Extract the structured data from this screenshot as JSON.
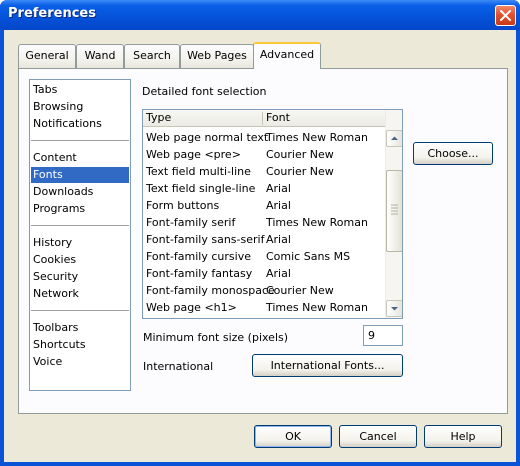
{
  "window": {
    "title": "Preferences"
  },
  "tabs": [
    {
      "label": "General"
    },
    {
      "label": "Wand"
    },
    {
      "label": "Search"
    },
    {
      "label": "Web Pages"
    },
    {
      "label": "Advanced"
    }
  ],
  "categories": {
    "groups": [
      [
        "Tabs",
        "Browsing",
        "Notifications"
      ],
      [
        "Content",
        "Fonts",
        "Downloads",
        "Programs"
      ],
      [
        "History",
        "Cookies",
        "Security",
        "Network"
      ],
      [
        "Toolbars",
        "Shortcuts",
        "Voice"
      ]
    ],
    "selected": "Fonts"
  },
  "fonts": {
    "section_label": "Detailed font selection",
    "columns": {
      "type": "Type",
      "font": "Font"
    },
    "rows": [
      {
        "type": "Web page normal text",
        "font": "Times New Roman"
      },
      {
        "type": "Web page <pre>",
        "font": "Courier New"
      },
      {
        "type": "Text field multi-line",
        "font": "Courier New"
      },
      {
        "type": "Text field single-line",
        "font": "Arial"
      },
      {
        "type": "Form buttons",
        "font": "Arial"
      },
      {
        "type": "Font-family serif",
        "font": "Times New Roman"
      },
      {
        "type": "Font-family sans-serif",
        "font": "Arial"
      },
      {
        "type": "Font-family cursive",
        "font": "Comic Sans MS"
      },
      {
        "type": "Font-family fantasy",
        "font": "Arial"
      },
      {
        "type": "Font-family monospace",
        "font": "Courier New"
      },
      {
        "type": "Web page <h1>",
        "font": "Times New Roman"
      }
    ],
    "choose_label": "Choose...",
    "min_size_label": "Minimum font size (pixels)",
    "min_size_value": "9",
    "international_label": "International",
    "international_button": "International Fonts..."
  },
  "dialog_buttons": {
    "ok": "OK",
    "cancel": "Cancel",
    "help": "Help"
  },
  "colors": {
    "title_bar": "#0553db",
    "selection": "#316ac5",
    "active_tab_accent": "#ffc83c",
    "close_button": "#e2502d"
  }
}
